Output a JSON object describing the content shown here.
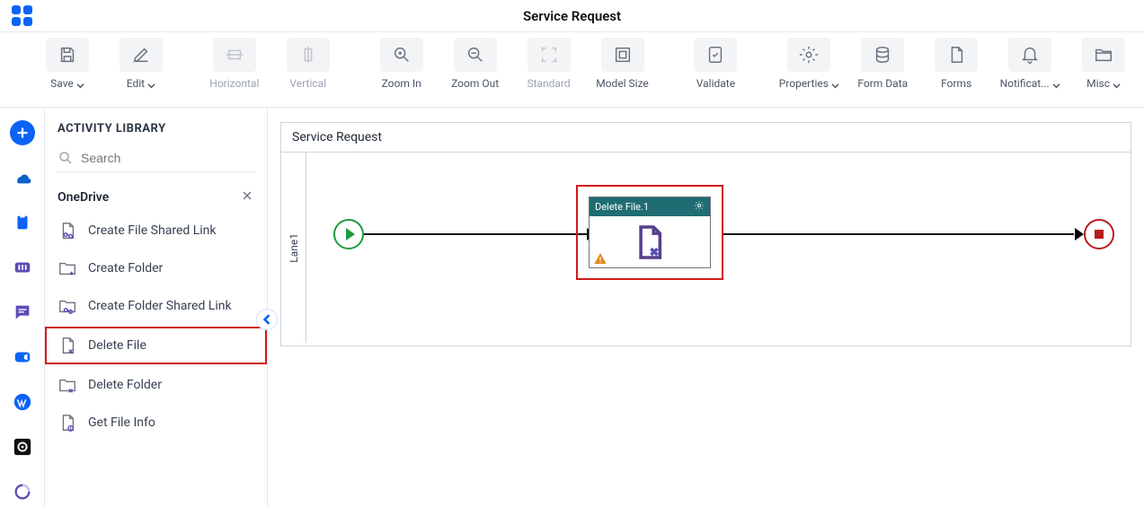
{
  "header": {
    "title": "Service Request"
  },
  "toolbar": {
    "save": "Save",
    "edit": "Edit",
    "horizontal": "Horizontal",
    "vertical": "Vertical",
    "zoom_in": "Zoom In",
    "zoom_out": "Zoom Out",
    "standard": "Standard",
    "model_size": "Model Size",
    "validate": "Validate",
    "properties": "Properties",
    "form_data": "Form Data",
    "forms": "Forms",
    "notifications": "Notificat...",
    "misc": "Misc"
  },
  "panel": {
    "title": "ACTIVITY LIBRARY",
    "search_placeholder": "Search",
    "group": "OneDrive",
    "items": [
      {
        "label": "Create File Shared Link"
      },
      {
        "label": "Create Folder"
      },
      {
        "label": "Create Folder Shared Link"
      },
      {
        "label": "Delete File",
        "highlight": true
      },
      {
        "label": "Delete Folder"
      },
      {
        "label": "Get File Info"
      }
    ]
  },
  "canvas": {
    "title": "Service Request",
    "lane": "Lane1",
    "task": "Delete File.1"
  }
}
